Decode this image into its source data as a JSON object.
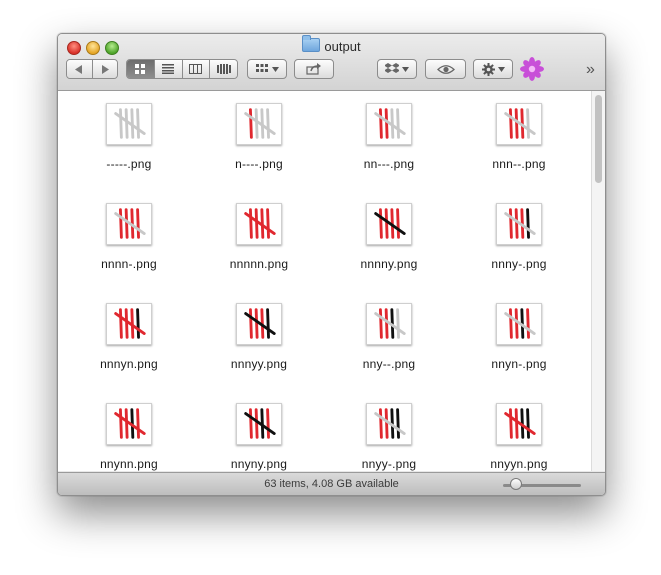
{
  "window": {
    "title": "output"
  },
  "toolbar": {
    "back_icon": "back-arrow-icon",
    "forward_icon": "forward-arrow-icon",
    "view_modes": [
      "icon-view-icon",
      "list-view-icon",
      "column-view-icon",
      "coverflow-view-icon"
    ],
    "arrange_icon": "arrange-grid-icon",
    "share_icon": "share-icon",
    "dropbox_icon": "dropbox-icon",
    "quicklook_icon": "eye-icon",
    "action_icon": "gear-icon",
    "extension_icon": "purple-flower-icon",
    "overflow_label": "»"
  },
  "files": [
    {
      "name": "-----.png",
      "marks": "-----"
    },
    {
      "name": "n----.png",
      "marks": "n----"
    },
    {
      "name": "nn---.png",
      "marks": "nn---"
    },
    {
      "name": "nnn--.png",
      "marks": "nnn--"
    },
    {
      "name": "nnnn-.png",
      "marks": "nnnn-"
    },
    {
      "name": "nnnnn.png",
      "marks": "nnnnn"
    },
    {
      "name": "nnnny.png",
      "marks": "nnnny"
    },
    {
      "name": "nnny-.png",
      "marks": "nnny-"
    },
    {
      "name": "nnnyn.png",
      "marks": "nnnyn"
    },
    {
      "name": "nnnyy.png",
      "marks": "nnnyy"
    },
    {
      "name": "nny--.png",
      "marks": "nny--"
    },
    {
      "name": "nnyn-.png",
      "marks": "nnyn-"
    },
    {
      "name": "nnynn.png",
      "marks": "nnynn"
    },
    {
      "name": "nnyny.png",
      "marks": "nnyny"
    },
    {
      "name": "nnyy-.png",
      "marks": "nnyy-"
    },
    {
      "name": "nnyyn.png",
      "marks": "nnyyn"
    }
  ],
  "colors": {
    "n": "#e0282f",
    "y": "#111111",
    "-": "#c8c8c8"
  },
  "status": {
    "text": "63 items, 4.08 GB available"
  }
}
